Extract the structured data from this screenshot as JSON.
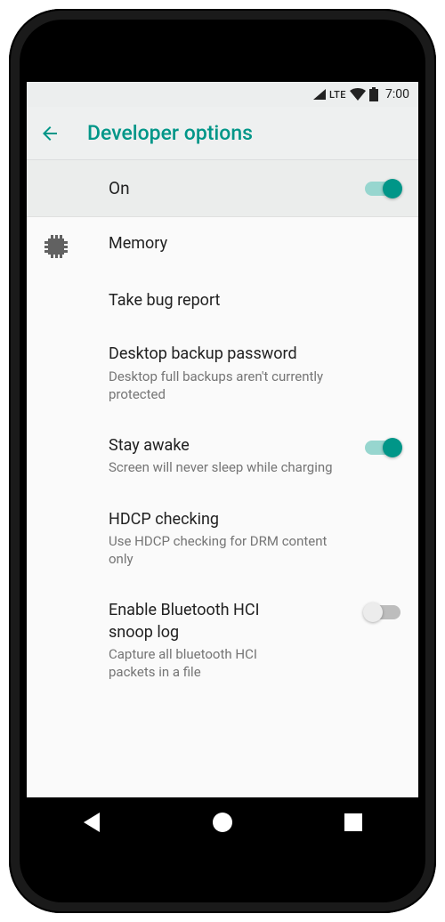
{
  "statusbar": {
    "network_label": "LTE",
    "time": "7:00"
  },
  "appbar": {
    "title": "Developer options"
  },
  "master": {
    "label": "On",
    "enabled": true
  },
  "settings": [
    {
      "key": "memory",
      "title": "Memory",
      "subtitle": null,
      "icon": "chip",
      "toggle": null
    },
    {
      "key": "bug_report",
      "title": "Take bug report",
      "subtitle": null,
      "icon": null,
      "toggle": null
    },
    {
      "key": "backup_pw",
      "title": "Desktop backup password",
      "subtitle": "Desktop full backups aren't currently protected",
      "icon": null,
      "toggle": null
    },
    {
      "key": "stay_awake",
      "title": "Stay awake",
      "subtitle": "Screen will never sleep while charging",
      "icon": null,
      "toggle": true
    },
    {
      "key": "hdcp",
      "title": "HDCP checking",
      "subtitle": "Use HDCP checking for DRM content only",
      "icon": null,
      "toggle": null
    },
    {
      "key": "bt_hci",
      "title": "Enable Bluetooth HCI snoop log",
      "subtitle": "Capture all bluetooth HCI packets in a file",
      "icon": null,
      "toggle": false
    }
  ],
  "colors": {
    "accent": "#009688"
  }
}
